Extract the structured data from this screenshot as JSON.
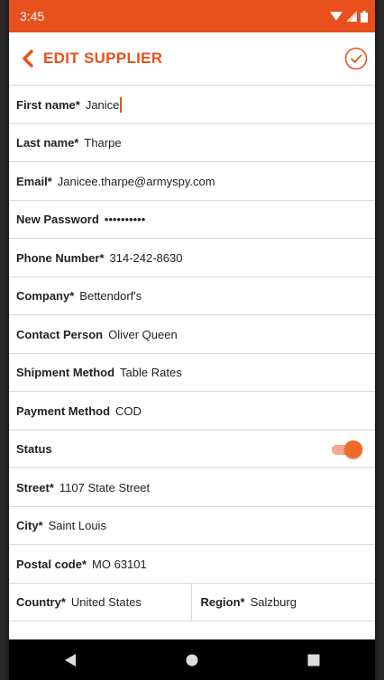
{
  "status_bar": {
    "time": "3:45"
  },
  "app_bar": {
    "title": "EDIT SUPPLIER",
    "back_icon": "chevron-left-icon",
    "confirm_icon": "check-circle-icon"
  },
  "fields": {
    "first_name": {
      "label": "First name*",
      "value": "Janice"
    },
    "last_name": {
      "label": "Last name*",
      "value": "Tharpe"
    },
    "email": {
      "label": "Email*",
      "value": "Janicee.tharpe@armyspy.com"
    },
    "password": {
      "label": "New Password",
      "value": "••••••••••"
    },
    "phone": {
      "label": "Phone Number*",
      "value": "314-242-8630"
    },
    "company": {
      "label": "Company*",
      "value": "Bettendorf's"
    },
    "contact_person": {
      "label": "Contact Person",
      "value": "Oliver Queen"
    },
    "shipment_method": {
      "label": "Shipment Method",
      "value": "Table Rates"
    },
    "payment_method": {
      "label": "Payment Method",
      "value": "COD"
    },
    "status": {
      "label": "Status",
      "enabled": true
    },
    "street": {
      "label": "Street*",
      "value": "1107 State Street"
    },
    "city": {
      "label": "City*",
      "value": "Saint Louis"
    },
    "postal_code": {
      "label": "Postal code*",
      "value": "MO 63101"
    },
    "country": {
      "label": "Country*",
      "value": "United States"
    },
    "region": {
      "label": "Region*",
      "value": "Salzburg"
    }
  },
  "colors": {
    "accent": "#e8501e",
    "toggle_on": "#f06a22"
  }
}
